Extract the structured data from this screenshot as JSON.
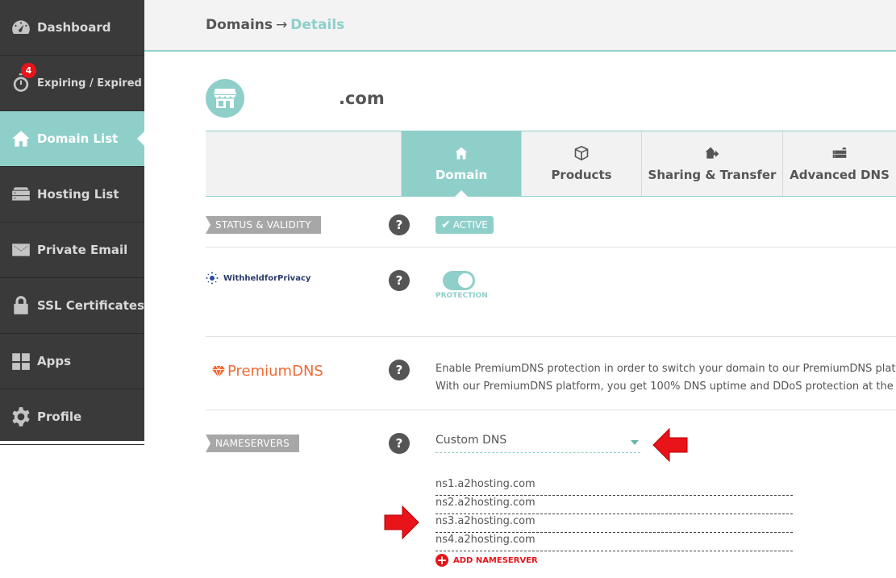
{
  "sidebar": {
    "items": [
      {
        "label": "Dashboard",
        "icon": "speedometer-icon"
      },
      {
        "label": "Expiring / Expired",
        "icon": "stopwatch-icon",
        "badge": "4"
      },
      {
        "label": "Domain List",
        "icon": "home-icon",
        "active": true
      },
      {
        "label": "Hosting List",
        "icon": "server-icon"
      },
      {
        "label": "Private Email",
        "icon": "envelope-icon"
      },
      {
        "label": "SSL Certificates",
        "icon": "lock-icon"
      },
      {
        "label": "Apps",
        "icon": "apps-icon"
      },
      {
        "label": "Profile",
        "icon": "gear-icon"
      }
    ]
  },
  "breadcrumb": {
    "root": "Domains",
    "separator": "→",
    "current": "Details"
  },
  "domain": {
    "name": ".com",
    "icon": "store-icon"
  },
  "tabs": [
    {
      "label": "Domain",
      "icon": "home-icon",
      "active": true
    },
    {
      "label": "Products",
      "icon": "box-icon"
    },
    {
      "label": "Sharing & Transfer",
      "icon": "share-icon"
    },
    {
      "label": "Advanced DNS",
      "icon": "dns-server-icon"
    }
  ],
  "status": {
    "tag": "STATUS & VALIDITY",
    "help": "?",
    "badge": "ACTIVE"
  },
  "privacy": {
    "logo_text": "WithheldforPrivacy",
    "help": "?",
    "toggle_label": "PROTECTION",
    "toggle_on": true
  },
  "premium_dns": {
    "logo_text": "PremiumDNS",
    "help": "?",
    "line1": "Enable PremiumDNS protection in order to switch your domain to our PremiumDNS platfo",
    "line2": "With our PremiumDNS platform, you get 100% DNS uptime and DDoS protection at the D"
  },
  "nameservers": {
    "tag": "NAMESERVERS",
    "help": "?",
    "selected": "Custom DNS",
    "servers": [
      "ns1.a2hosting.com",
      "ns2.a2hosting.com",
      "ns3.a2hosting.com",
      "ns4.a2hosting.com"
    ],
    "add_label": "ADD NAMESERVER"
  },
  "colors": {
    "accent": "#8fcfca",
    "sidebar": "#3a3a3a",
    "alert": "#e8141a",
    "premium": "#f06a35"
  }
}
